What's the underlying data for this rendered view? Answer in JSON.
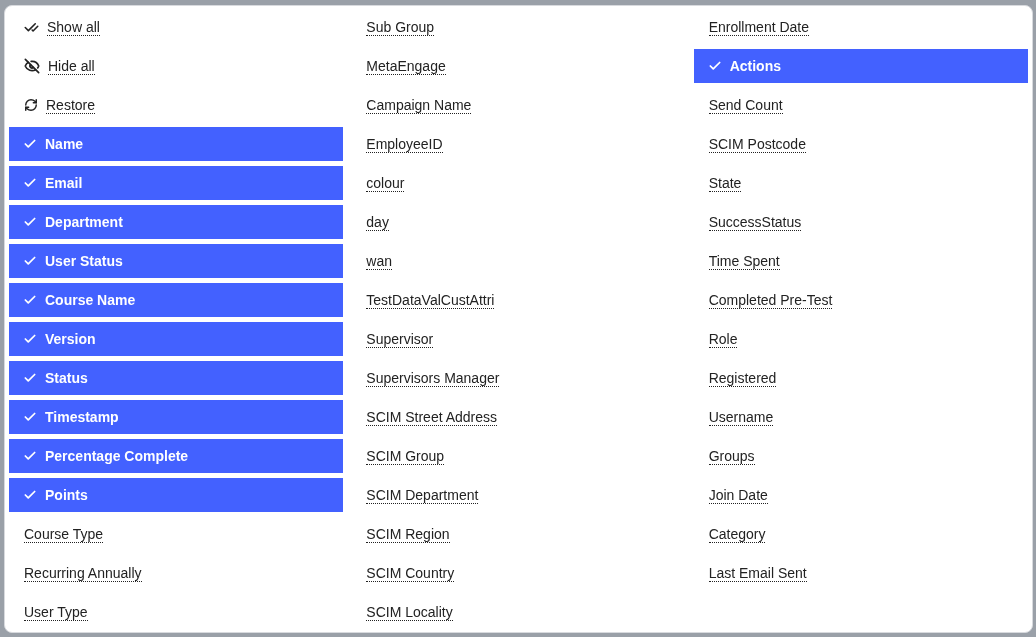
{
  "actions": [
    {
      "kind": "show_all",
      "label": "Show all"
    },
    {
      "kind": "hide_all",
      "label": "Hide all"
    },
    {
      "kind": "restore",
      "label": "Restore"
    }
  ],
  "columns": [
    {
      "label": "Name",
      "selected": true
    },
    {
      "label": "Email",
      "selected": true
    },
    {
      "label": "Department",
      "selected": true
    },
    {
      "label": "User Status",
      "selected": true
    },
    {
      "label": "Course Name",
      "selected": true
    },
    {
      "label": "Version",
      "selected": true
    },
    {
      "label": "Status",
      "selected": true
    },
    {
      "label": "Timestamp",
      "selected": true
    },
    {
      "label": "Percentage Complete",
      "selected": true
    },
    {
      "label": "Points",
      "selected": true
    },
    {
      "label": "Course Type",
      "selected": false
    },
    {
      "label": "Recurring Annually",
      "selected": false
    },
    {
      "label": "User Type",
      "selected": false
    },
    {
      "label": "Sub Group",
      "selected": false
    },
    {
      "label": "MetaEngage",
      "selected": false
    },
    {
      "label": "Campaign Name",
      "selected": false
    },
    {
      "label": "EmployeeID",
      "selected": false
    },
    {
      "label": "colour",
      "selected": false
    },
    {
      "label": "day",
      "selected": false
    },
    {
      "label": "wan",
      "selected": false
    },
    {
      "label": "TestDataValCustAttri",
      "selected": false
    },
    {
      "label": "Supervisor",
      "selected": false
    },
    {
      "label": "Supervisors Manager",
      "selected": false
    },
    {
      "label": "SCIM Street Address",
      "selected": false
    },
    {
      "label": "SCIM Group",
      "selected": false
    },
    {
      "label": "SCIM Department",
      "selected": false
    },
    {
      "label": "SCIM Region",
      "selected": false
    },
    {
      "label": "SCIM Country",
      "selected": false
    },
    {
      "label": "SCIM Locality",
      "selected": false
    },
    {
      "label": "Enrollment Date",
      "selected": false
    },
    {
      "label": "Actions",
      "selected": true
    },
    {
      "label": "Send Count",
      "selected": false
    },
    {
      "label": "SCIM Postcode",
      "selected": false
    },
    {
      "label": "State",
      "selected": false
    },
    {
      "label": "SuccessStatus",
      "selected": false
    },
    {
      "label": "Time Spent",
      "selected": false
    },
    {
      "label": "Completed Pre-Test",
      "selected": false
    },
    {
      "label": "Role",
      "selected": false
    },
    {
      "label": "Registered",
      "selected": false
    },
    {
      "label": "Username",
      "selected": false
    },
    {
      "label": "Groups",
      "selected": false
    },
    {
      "label": "Join Date",
      "selected": false
    },
    {
      "label": "Category",
      "selected": false
    },
    {
      "label": "Last Email Sent",
      "selected": false
    }
  ]
}
